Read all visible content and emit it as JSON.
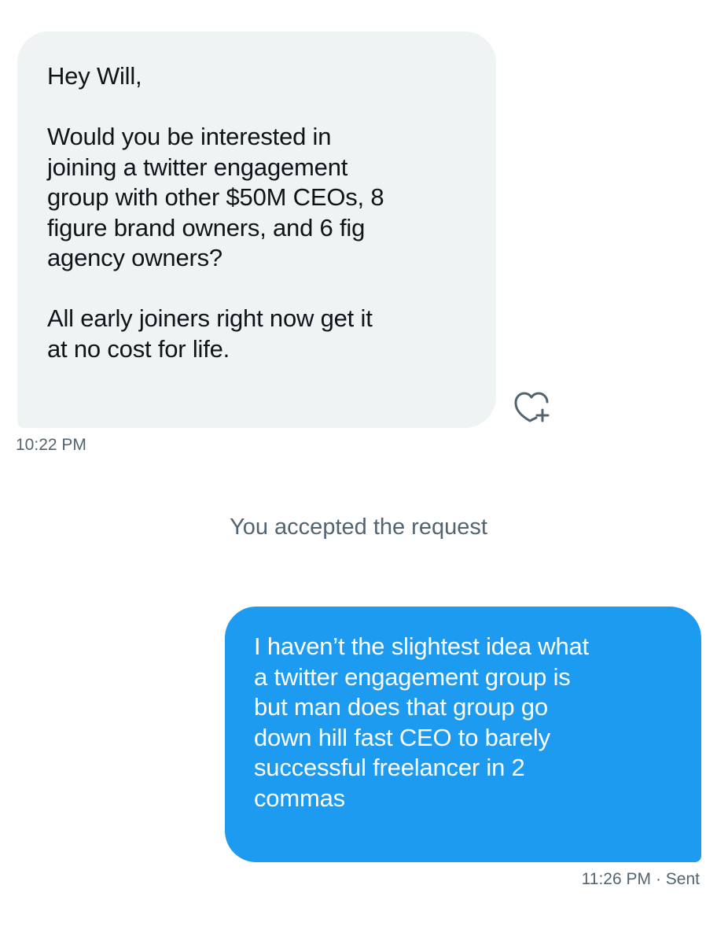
{
  "conversation": {
    "incoming": {
      "paragraphs": [
        "Hey Will,",
        "Would you be interested in joining a twitter engagement group with other $50M CEOs, 8 figure brand owners, and 6 fig agency owners?",
        "All early joiners right now get it at no cost for life."
      ],
      "lines": [
        [
          "Hey Will,"
        ],
        [
          "Would you be interested in",
          "joining a twitter engagement",
          "group with other $50M CEOs, 8",
          "figure brand owners, and 6 fig",
          "agency owners?"
        ],
        [
          "All early joiners right now get it",
          "at no cost for life."
        ]
      ],
      "timestamp": "10:22 PM",
      "react_icon": "heart-plus-icon"
    },
    "system_note": "You accepted the request",
    "outgoing": {
      "lines": [
        "I haven’t the slightest idea what",
        "a twitter engagement group is",
        "but man does that group go",
        "down hill fast CEO to barely",
        "successful freelancer in 2",
        "commas"
      ],
      "timestamp": "11:26 PM",
      "status": "· Sent"
    }
  },
  "colors": {
    "incoming_bubble": "#eff3f4",
    "outgoing_bubble": "#1d9bf0",
    "secondary_text": "#536471",
    "primary_text": "#0f1419"
  }
}
